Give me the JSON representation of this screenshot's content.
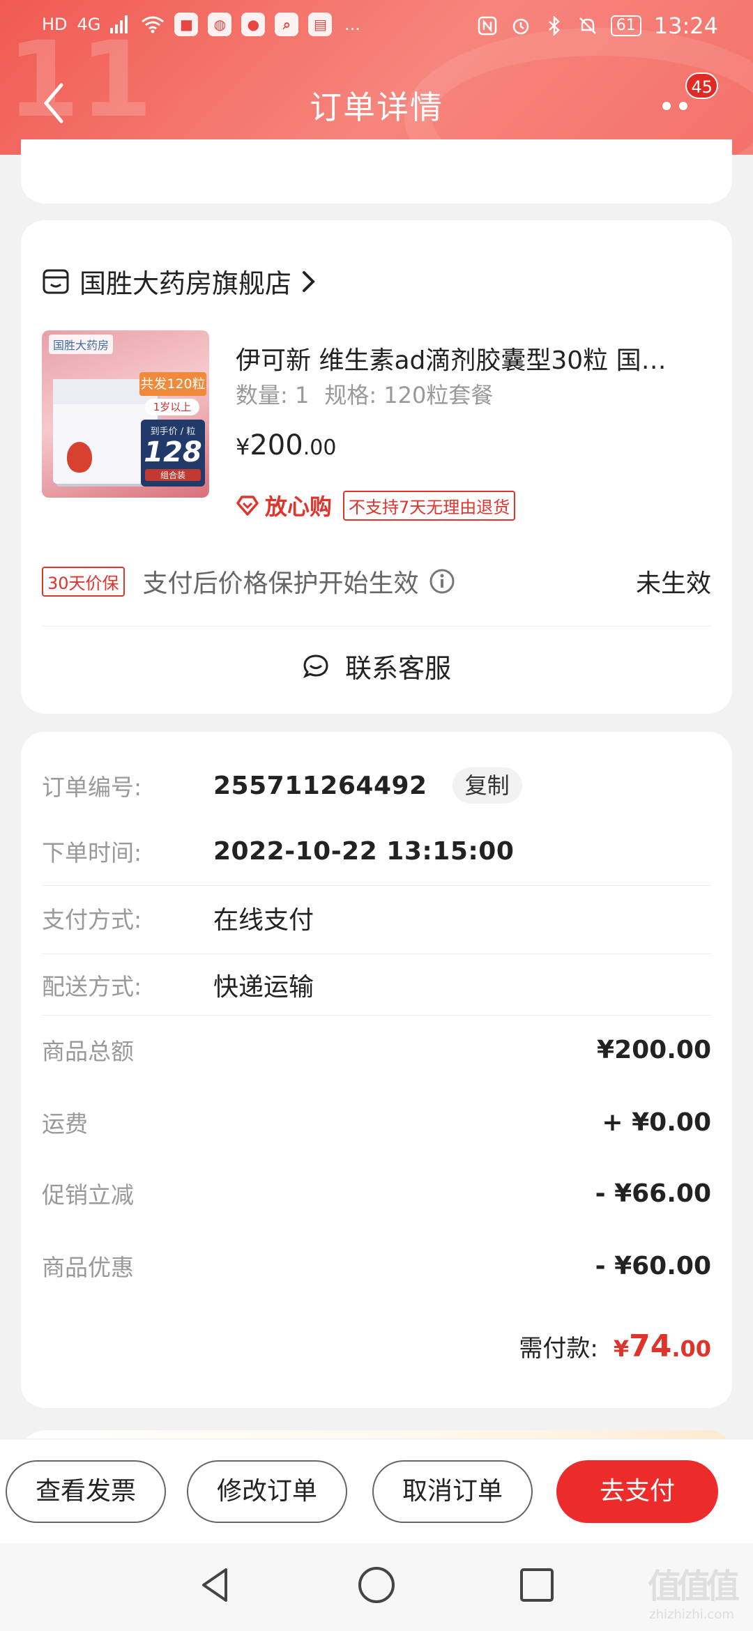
{
  "status_bar": {
    "left_icons": [
      "HD",
      "4G",
      "signal-icon",
      "wifi-icon",
      "app-icon-1",
      "wechat-icon",
      "qq-icon",
      "search-app-icon",
      "book-app-icon",
      "..."
    ],
    "right_icons": [
      "nfc-icon",
      "alarm-icon",
      "bluetooth-icon",
      "mute-icon"
    ],
    "battery": "61",
    "time": "13:24"
  },
  "header": {
    "title": "订单详情",
    "badge_count": "45",
    "bg_color": "#f05a52"
  },
  "store": {
    "name": "国胜大药房旗舰店"
  },
  "product": {
    "title": "伊可新 维生素ad滴剂胶囊型30粒 国…",
    "quantity": "数量: 1",
    "spec": "规格: 120粒套餐",
    "price_symbol": "¥",
    "price_int": "200",
    "price_dec": ".00",
    "assure_label": "放心购",
    "return_tag": "不支持7天无理由退货",
    "image": {
      "brand": "国胜大药房",
      "tag1": "共发120粒",
      "tag2": "1岁以上",
      "box_label": "到手价 / 粒",
      "box_price": "128",
      "box_sub": "组合装"
    }
  },
  "price_protect": {
    "tag": "30天价保",
    "text": "支付后价格保护开始生效",
    "status": "未生效"
  },
  "customer_service": {
    "label": "联系客服"
  },
  "order": {
    "number_label": "订单编号:",
    "number": "255711264492",
    "copy_label": "复制",
    "time_label": "下单时间:",
    "time": "2022-10-22 13:15:00",
    "pay_method_label": "支付方式:",
    "pay_method": "在线支付",
    "delivery_label": "配送方式:",
    "delivery": "快递运输"
  },
  "amounts": [
    {
      "label": "商品总额",
      "value": "¥200.00"
    },
    {
      "label": "运费",
      "value": "+ ¥0.00"
    },
    {
      "label": "促销立减",
      "value": "- ¥66.00"
    },
    {
      "label": "商品优惠",
      "value": "- ¥60.00"
    }
  ],
  "total": {
    "label": "需付款:",
    "symbol": "¥",
    "int": "74",
    "dec": ".00"
  },
  "actions": {
    "invoice": "查看发票",
    "modify": "修改订单",
    "cancel": "取消订单",
    "pay": "去支付"
  },
  "watermark": {
    "big": "值值值",
    "small": "zhizhizhi.com"
  },
  "accent_color": "#e0332b"
}
